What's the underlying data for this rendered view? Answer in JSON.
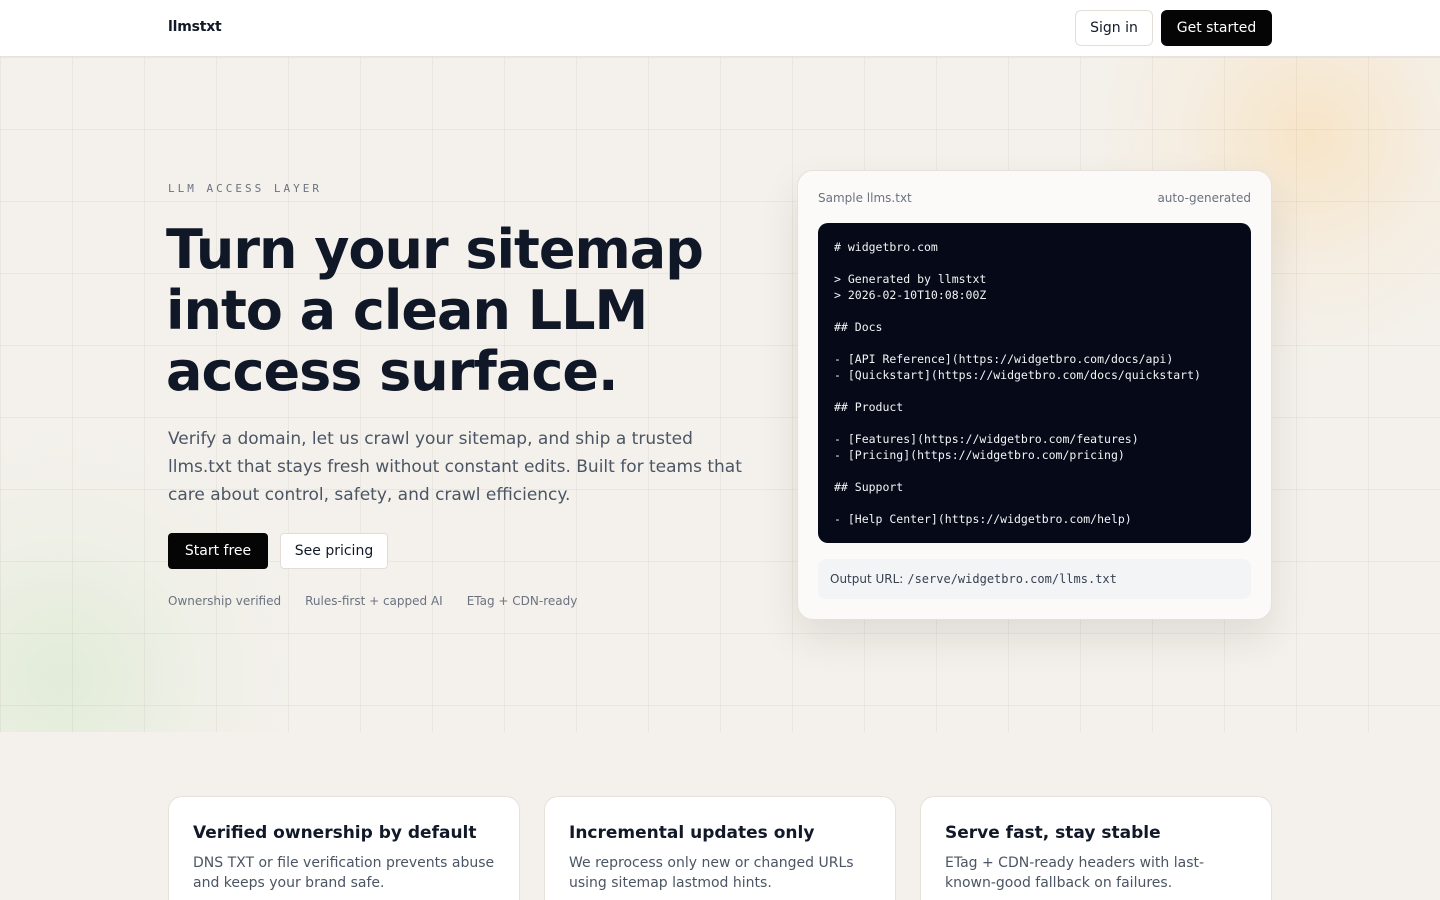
{
  "header": {
    "brand": "llmstxt",
    "sign_in": "Sign in",
    "get_started": "Get started"
  },
  "hero": {
    "eyebrow": "LLM ACCESS LAYER",
    "headline": "Turn your sitemap into a clean LLM access surface.",
    "subtext": "Verify a domain, let us crawl your sitemap, and ship a trusted llms.txt that stays fresh without constant edits. Built for teams that care about control, safety, and crawl efficiency.",
    "primary_cta": "Start free",
    "secondary_cta": "See pricing",
    "badges": [
      "Ownership verified",
      "Rules-first + capped AI",
      "ETag + CDN-ready"
    ]
  },
  "sample": {
    "label": "Sample llms.txt",
    "tag": "auto-generated",
    "code": "# widgetbro.com\n\n> Generated by llmstxt\n> 2026-02-10T10:08:00Z\n\n## Docs\n\n- [API Reference](https://widgetbro.com/docs/api)\n- [Quickstart](https://widgetbro.com/docs/quickstart)\n\n## Product\n\n- [Features](https://widgetbro.com/features)\n- [Pricing](https://widgetbro.com/pricing)\n\n## Support\n\n- [Help Center](https://widgetbro.com/help)",
    "output_label": "Output URL:",
    "output_url": "/serve/widgetbro.com/llms.txt"
  },
  "features": [
    {
      "title": "Verified ownership by default",
      "desc": "DNS TXT or file verification prevents abuse and keeps your brand safe."
    },
    {
      "title": "Incremental updates only",
      "desc": "We reprocess only new or changed URLs using sitemap lastmod hints."
    },
    {
      "title": "Serve fast, stay stable",
      "desc": "ETag + CDN-ready headers with last-known-good fallback on failures."
    }
  ],
  "colors": {
    "background": "#f4f1ec",
    "primary": "#050505",
    "code_bg": "#060a18",
    "heading": "#101828",
    "muted": "#6b7280"
  }
}
